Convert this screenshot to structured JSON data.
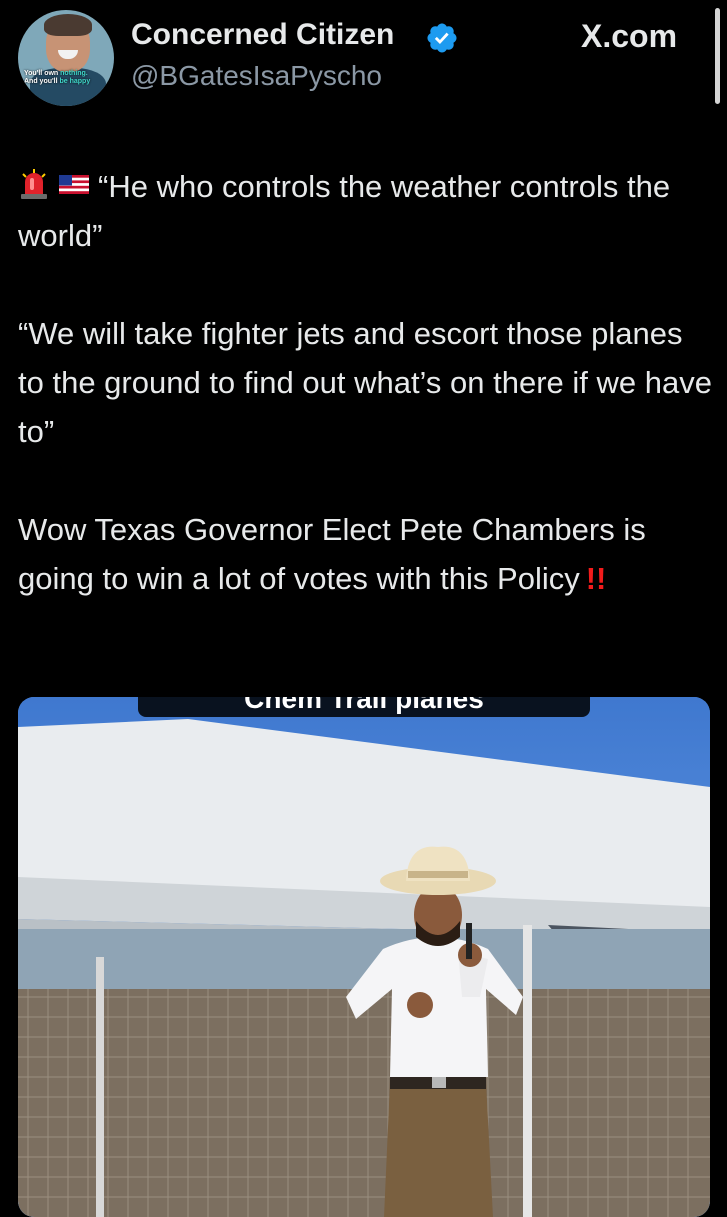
{
  "profile": {
    "display_name": "Concerned Citizen",
    "handle": "@BGatesIsaPyscho",
    "avatar_caption_line1_a": "You'll own ",
    "avatar_caption_line1_b": "nothing.",
    "avatar_caption_line2_a": "And you'll ",
    "avatar_caption_line2_b": "be happy"
  },
  "brand": {
    "site_label": "X.com"
  },
  "tweet": {
    "line1_quote": "“He who controls the weather controls the world”",
    "paragraph2": "“We will take fighter jets and escort those planes to the ground to find out what’s on there if we have to”",
    "paragraph3": "Wow Texas Governor Elect Pete Chambers is going to win a lot of votes with this Policy",
    "bangs": "!!",
    "emoji_icons": [
      "police-light-icon",
      "us-flag-icon"
    ]
  },
  "media": {
    "caption_partial": "Chem Trail planes"
  },
  "colors": {
    "background": "#000000",
    "text": "#e7e9ea",
    "muted": "#8b98a5",
    "verified": "#1d9bf0",
    "alert": "#f21b1b"
  }
}
